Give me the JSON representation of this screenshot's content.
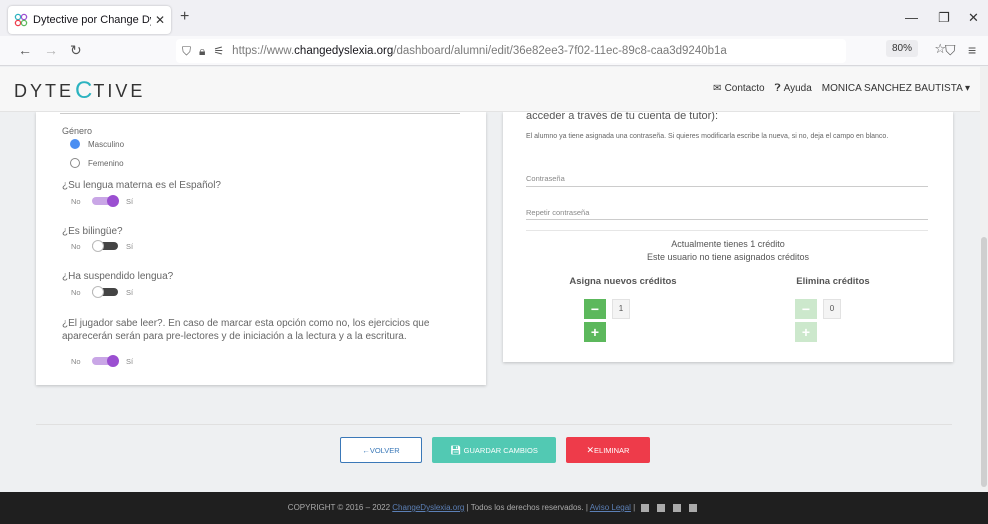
{
  "browser": {
    "tab_title": "Dytective por Change Dyslexia",
    "url_prefix": "https://www.",
    "url_host": "changedyslexia.org",
    "url_path": "/dashboard/alumni/edit/36e82ee3-7f02-11ec-89c8-caa3d9240b1a",
    "zoom": "80%"
  },
  "header": {
    "logo_left": "DYTE",
    "logo_mid": "C",
    "logo_right": "TIVE",
    "contact": "Contacto",
    "help": "Ayuda",
    "user": "MONICA SANCHEZ BAUTISTA"
  },
  "left": {
    "gender_label": "Género",
    "gender_male": "Masculino",
    "gender_female": "Femenino",
    "q1": "¿Su lengua materna es el Español?",
    "q2": "¿Es bilingüe?",
    "q3": "¿Ha suspendido lengua?",
    "q4": "¿El jugador sabe leer?. En caso de marcar esta opción como no, los ejercicios que aparecerán serán para pre-lectores y de iniciación a la lectura y a la escritura.",
    "no": "No",
    "yes": "Sí",
    "toggles": {
      "q1": true,
      "q2": false,
      "q3": false,
      "q4": true
    }
  },
  "right": {
    "title": "acceder a través de tu cuenta de tutor):",
    "note": "El alumno ya tiene asignada una contraseña. Si quieres modificarla escribe la nueva, si no, deja el campo en blanco.",
    "password_label": "Contraseña",
    "repeat_label": "Repetir contraseña",
    "credits_line1": "Actualmente tienes 1 crédito",
    "credits_line2": "Este usuario no tiene asignados créditos",
    "assign_title": "Asigna nuevos créditos",
    "remove_title": "Elimina créditos",
    "assign_value": "1",
    "remove_value": "0"
  },
  "buttons": {
    "back": "VOLVER",
    "save": "GUARDAR CAMBIOS",
    "delete": "ELIMINAR"
  },
  "footer": {
    "text_before": "COPYRIGHT © 2016 – 2022 ",
    "link1": "ChangeDyslexia.org",
    "text_mid": " | Todos los derechos reservados. | ",
    "link2": "Aviso Legal",
    "text_after": " |"
  },
  "colors": {
    "green": "#5cb85c",
    "purple_toggle": "#9b4fd1",
    "teal_save": "#52c9b3",
    "red_delete": "#ee3b4a",
    "logo_teal": "#2bb3c0"
  }
}
